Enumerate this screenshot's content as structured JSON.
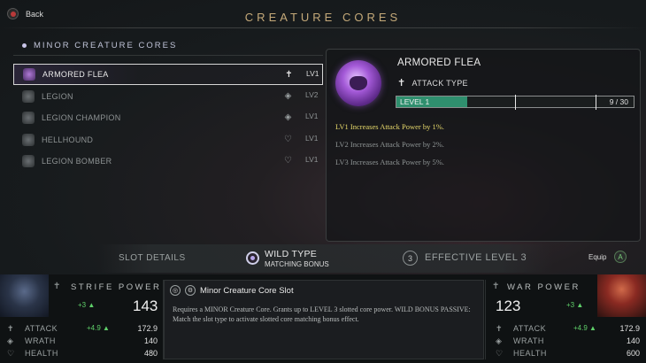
{
  "header": {
    "back_label": "Back",
    "title": "CREATURE CORES"
  },
  "list": {
    "heading": "MINOR CREATURE CORES",
    "items": [
      {
        "name": "ARMORED FLEA",
        "type_icon": "attack-type-icon",
        "level": "LV1",
        "selected": true
      },
      {
        "name": "LEGION",
        "type_icon": "wild-type-icon",
        "level": "LV2",
        "selected": false
      },
      {
        "name": "LEGION CHAMPION",
        "type_icon": "wild-type-icon",
        "level": "LV1",
        "selected": false
      },
      {
        "name": "HELLHOUND",
        "type_icon": "health-type-icon",
        "level": "LV1",
        "selected": false
      },
      {
        "name": "LEGION BOMBER",
        "type_icon": "health-type-icon",
        "level": "LV1",
        "selected": false
      }
    ]
  },
  "detail": {
    "name": "ARMORED FLEA",
    "type": "ATTACK TYPE",
    "level_label": "LEVEL 1",
    "level_count": "9 / 30",
    "progress": 0.3,
    "levels": [
      "LV1 Increases Attack Power by 1%.",
      "LV2 Increases Attack Power by 2%.",
      "LV3 Increases Attack Power by 5%."
    ]
  },
  "slot_bar": {
    "slot_details": "SLOT DETAILS",
    "wild_type": "WILD TYPE",
    "matching_bonus": "MATCHING BONUS",
    "effective_num": "3",
    "effective_level": "EFFECTIVE LEVEL 3",
    "equip_label": "Equip",
    "equip_button": "A"
  },
  "strife": {
    "title": "STRIFE POWER",
    "bonus": "+3",
    "value": "143",
    "stats": [
      {
        "name": "ATTACK",
        "bonus": "+4.9",
        "value": "172.9"
      },
      {
        "name": "WRATH",
        "bonus": "",
        "value": "140"
      },
      {
        "name": "HEALTH",
        "bonus": "",
        "value": "480"
      }
    ]
  },
  "war": {
    "title": "WAR POWER",
    "bonus": "+3",
    "value": "123",
    "stats": [
      {
        "name": "ATTACK",
        "bonus": "+4.9",
        "value": "172.9"
      },
      {
        "name": "WRATH",
        "bonus": "",
        "value": "140"
      },
      {
        "name": "HEALTH",
        "bonus": "",
        "value": "600"
      }
    ]
  },
  "info": {
    "title": "Minor Creature Core Slot",
    "text": "Requires a MINOR Creature Core. Grants up to LEVEL 3 slotted core power. WILD BONUS PASSIVE: Match the slot type to activate slotted core matching bonus effect."
  }
}
